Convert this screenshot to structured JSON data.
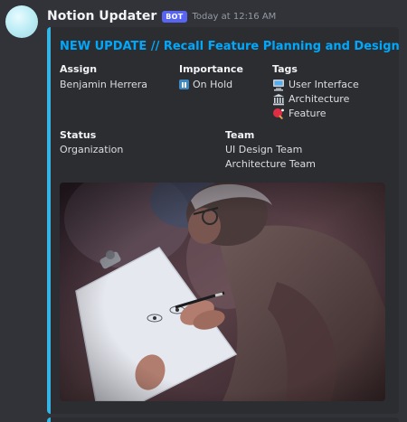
{
  "message": {
    "username": "Notion Updater",
    "badge": "BOT",
    "timestamp": "Today at 12:16 AM"
  },
  "embed": {
    "accent_color": "#34b5e5",
    "title": "NEW UPDATE // Recall Feature Planning and Design",
    "fields": {
      "assign": {
        "name": "Assign",
        "value": "Benjamin Herrera"
      },
      "importance": {
        "name": "Importance",
        "value": "On Hold",
        "icon": "pause-button-icon"
      },
      "tags": {
        "name": "Tags",
        "items": [
          {
            "label": "User Interface",
            "icon": "computer-icon"
          },
          {
            "label": "Architecture",
            "icon": "classical-building-icon"
          },
          {
            "label": "Feature",
            "icon": "ping-pong-icon"
          }
        ]
      },
      "status": {
        "name": "Status",
        "value": "Organization"
      },
      "team": {
        "name": "Team",
        "values": [
          "UI Design Team",
          "Architecture Team"
        ]
      }
    },
    "image": {
      "subject": "person sketching eyes on a clipboard"
    }
  }
}
